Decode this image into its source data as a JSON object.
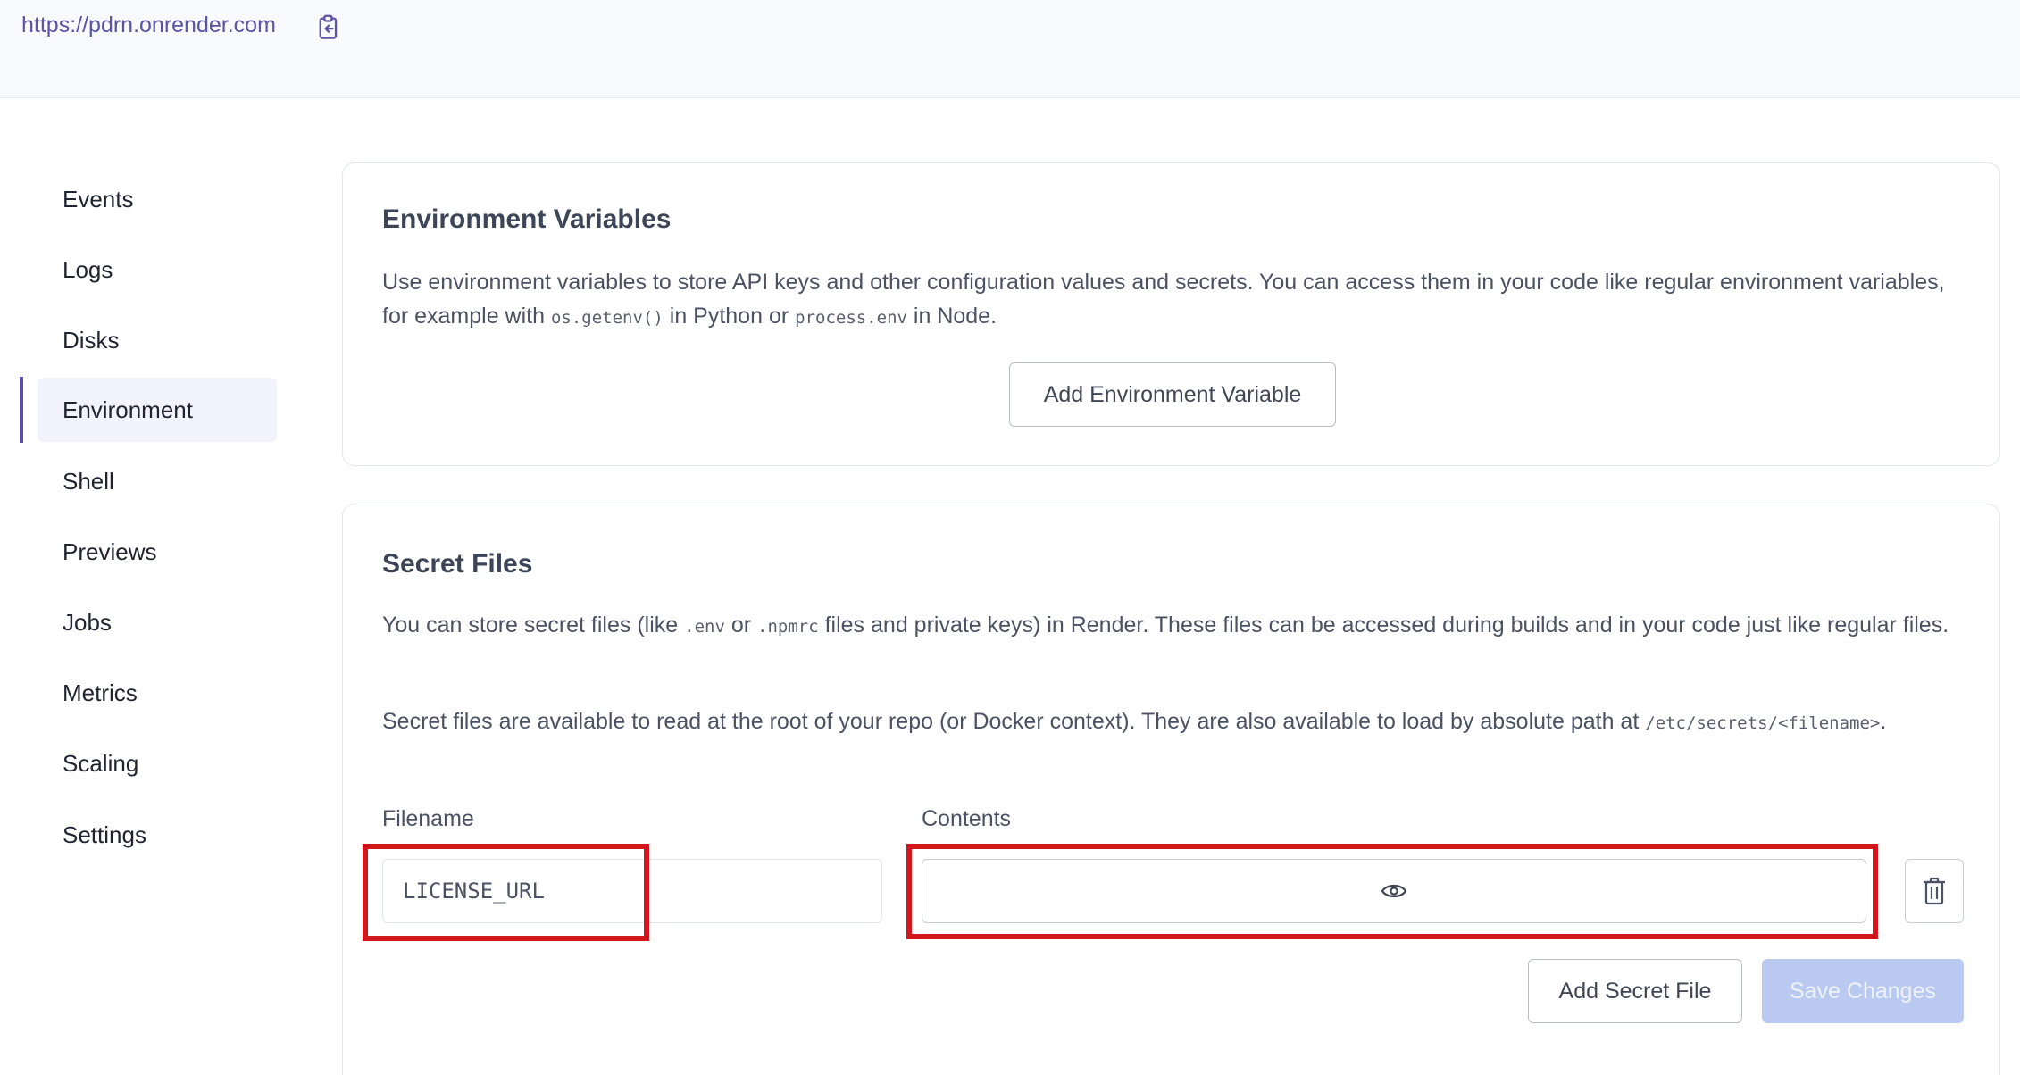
{
  "topbar": {
    "url": "https://pdrn.onrender.com",
    "copy_icon": "clipboard-icon"
  },
  "sidebar": {
    "items": [
      {
        "label": "Events",
        "active": false
      },
      {
        "label": "Logs",
        "active": false
      },
      {
        "label": "Disks",
        "active": false
      },
      {
        "label": "Environment",
        "active": true
      },
      {
        "label": "Shell",
        "active": false
      },
      {
        "label": "Previews",
        "active": false
      },
      {
        "label": "Jobs",
        "active": false
      },
      {
        "label": "Metrics",
        "active": false
      },
      {
        "label": "Scaling",
        "active": false
      },
      {
        "label": "Settings",
        "active": false
      }
    ]
  },
  "env_vars": {
    "title": "Environment Variables",
    "desc_part1": "Use environment variables to store API keys and other configuration values and secrets. You can access them in your code like regular environment variables, for example with ",
    "code1": "os.getenv()",
    "desc_part2": " in Python or ",
    "code2": "process.env",
    "desc_part3": " in Node.",
    "add_button": "Add Environment Variable"
  },
  "secret_files": {
    "title": "Secret Files",
    "desc1_part1": "You can store secret files (like ",
    "desc1_code1": ".env",
    "desc1_part2": " or ",
    "desc1_code2": ".npmrc",
    "desc1_part3": " files and private keys) in Render. These files can be accessed during builds and in your code just like regular files.",
    "desc2_part1": "Secret files are available to read at the root of your repo (or Docker context). They are also available to load by absolute path at ",
    "desc2_code": "/etc/secrets/<filename>",
    "desc2_part2": ".",
    "filename_label": "Filename",
    "contents_label": "Contents",
    "filename_value": "LICENSE_URL",
    "contents_icon": "eye-icon",
    "delete_icon": "trash-icon",
    "add_secret_button": "Add Secret File",
    "save_button": "Save Changes"
  },
  "colors": {
    "accent": "#5b4fb4",
    "link": "#5b53a6",
    "highlight": "#d3151c",
    "disabled_button": "#b9c9ef"
  }
}
